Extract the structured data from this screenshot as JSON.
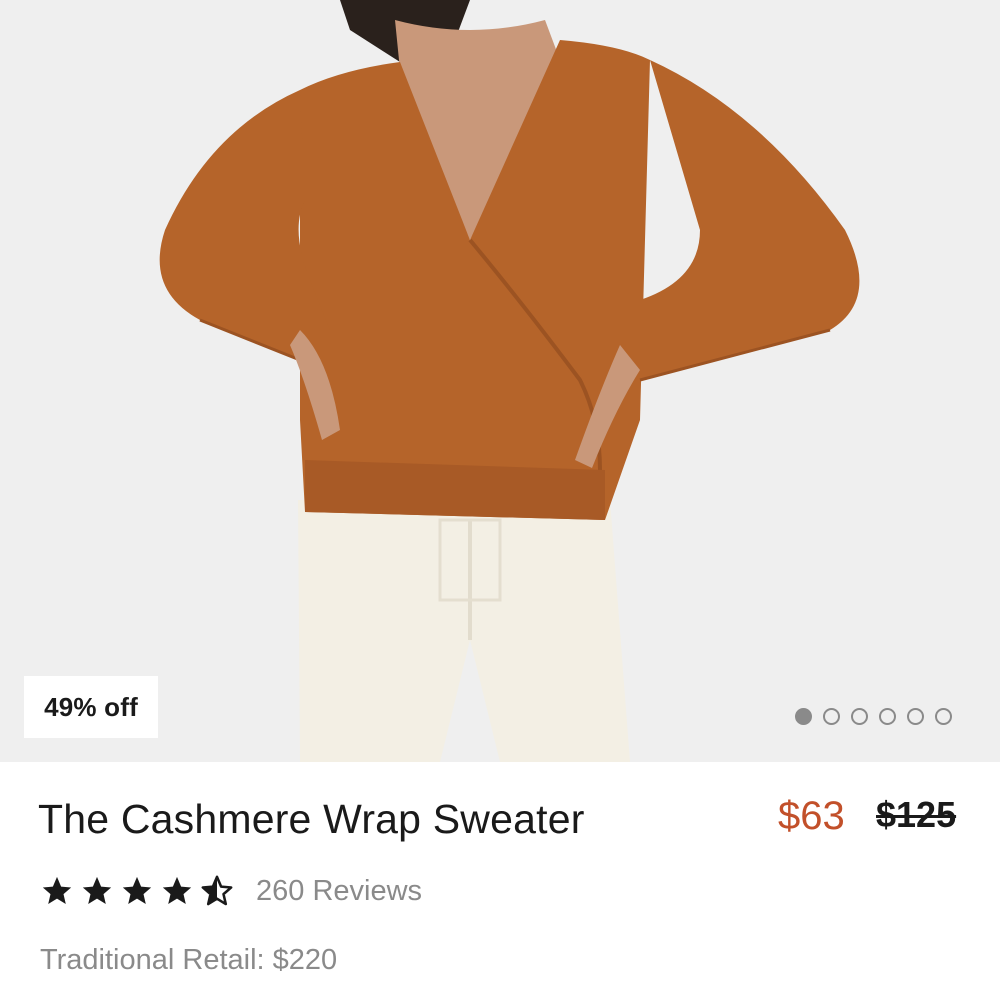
{
  "product": {
    "discount_badge": "49% off",
    "title": "The Cashmere Wrap Sweater",
    "sale_price": "$63",
    "original_price": "$125",
    "rating": 4.5,
    "rating_max": 5,
    "reviews_label": "260 Reviews",
    "traditional_retail": "Traditional Retail: $220"
  },
  "gallery": {
    "image_count": 6,
    "active_index": 0
  },
  "colors": {
    "sale_price": "#c2502a",
    "sweater": "#b5642a",
    "pants": "#f3efe4",
    "background": "#efefef"
  }
}
